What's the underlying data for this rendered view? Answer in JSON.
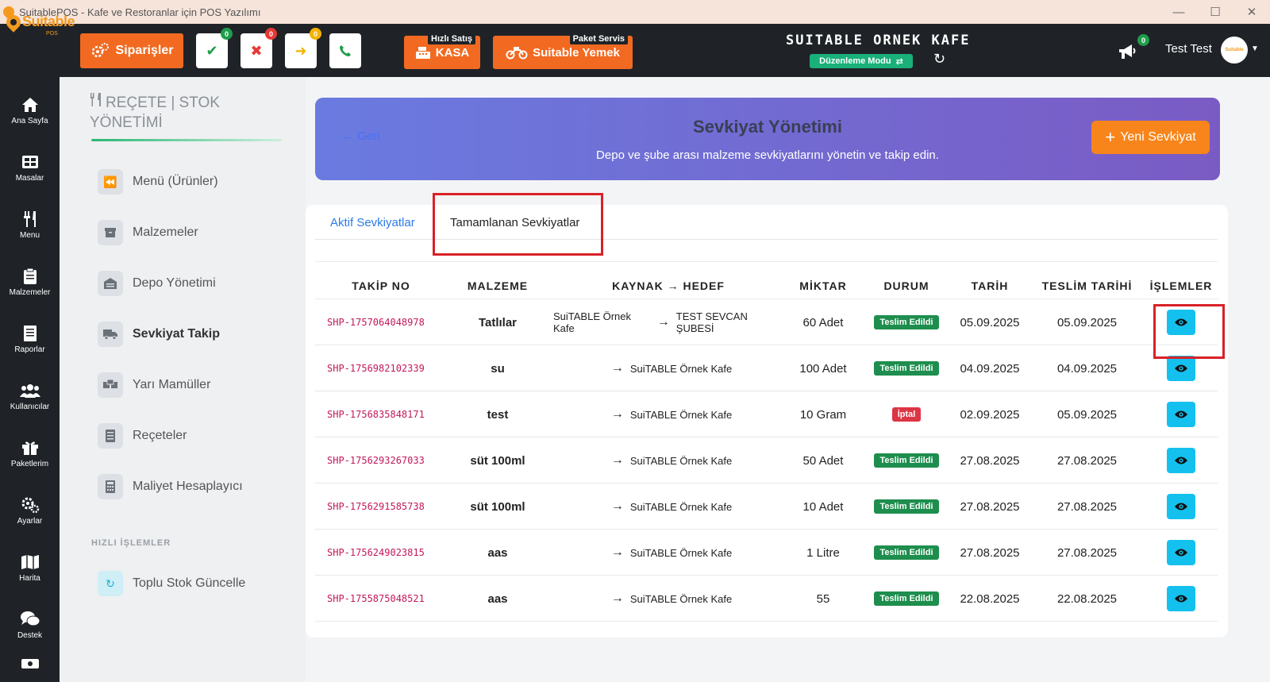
{
  "window": {
    "title": "SuitablePOS - Kafe ve Restoranlar için POS Yazılımı"
  },
  "header": {
    "logo_text": "Suitable",
    "logo_sub": "POS",
    "orders_label": "Siparişler",
    "badges": {
      "approved": "0",
      "cancelled": "0",
      "waiting": "0"
    },
    "quick_sale_label": "Hızlı Satış",
    "kasa_label": "KASA",
    "package_label": "Paket Servis",
    "suitable_yemek_label": "Suitable Yemek",
    "cafe_name": "SUITABLE ORNEK KAFE",
    "mode_label": "Düzenleme Modu",
    "notif_count": "0",
    "user_name": "Test Test",
    "avatar_text": "Suitable"
  },
  "rail": {
    "items": [
      {
        "label": "Ana Sayfa",
        "icon": "home-icon"
      },
      {
        "label": "Masalar",
        "icon": "table-icon"
      },
      {
        "label": "Menu",
        "icon": "utensils-icon"
      },
      {
        "label": "Malzemeler",
        "icon": "clipboard-icon"
      },
      {
        "label": "Raporlar",
        "icon": "report-icon"
      },
      {
        "label": "Kullanıcılar",
        "icon": "users-icon"
      },
      {
        "label": "Paketlerim",
        "icon": "gift-icon"
      },
      {
        "label": "Ayarlar",
        "icon": "gears-icon"
      },
      {
        "label": "Harita",
        "icon": "map-icon"
      },
      {
        "label": "Destek",
        "icon": "chat-icon"
      }
    ]
  },
  "subnav": {
    "heading": "REÇETE | STOK YÖNETİMİ",
    "items": [
      {
        "label": "Menü (Ürünler)",
        "icon": "backward-icon"
      },
      {
        "label": "Malzemeler",
        "icon": "box-icon"
      },
      {
        "label": "Depo Yönetimi",
        "icon": "warehouse-icon"
      },
      {
        "label": "Sevkiyat Takip",
        "icon": "truck-icon"
      },
      {
        "label": "Yarı Mamüller",
        "icon": "boxes-icon"
      },
      {
        "label": "Reçeteler",
        "icon": "list-icon"
      },
      {
        "label": "Maliyet Hesaplayıcı",
        "icon": "calculator-icon"
      }
    ],
    "quick_heading": "HIZLI İŞLEMLER",
    "quick_item": "Toplu Stok Güncelle"
  },
  "banner": {
    "back_label": "Geri",
    "title": "Sevkiyat Yönetimi",
    "subtitle": "Depo ve şube arası malzeme sevkiyatlarını yönetin ve takip edin.",
    "new_label": "Yeni Sevkiyat"
  },
  "tabs": {
    "active": "Aktif Sevkiyatlar",
    "completed": "Tamamlanan Sevkiyatlar"
  },
  "table": {
    "headers": [
      "TAKİP NO",
      "MALZEME",
      "KAYNAK → HEDEF",
      "MİKTAR",
      "DURUM",
      "TARİH",
      "TESLİM TARİHİ",
      "İŞLEMLER"
    ],
    "rows": [
      {
        "code": "SHP-1757064048978",
        "name": "Tatlılar",
        "source": "SuiTABLE Örnek Kafe",
        "target": "TEST SEVCAN ŞUBESİ",
        "qty": "60 Adet",
        "status": "Teslim Edildi",
        "date": "05.09.2025",
        "delivered": "05.09.2025"
      },
      {
        "code": "SHP-1756982102339",
        "name": "su",
        "source": "",
        "target": "SuiTABLE Örnek Kafe",
        "qty": "100 Adet",
        "status": "Teslim Edildi",
        "date": "04.09.2025",
        "delivered": "04.09.2025"
      },
      {
        "code": "SHP-1756835848171",
        "name": "test",
        "source": "",
        "target": "SuiTABLE Örnek Kafe",
        "qty": "10 Gram",
        "status": "İptal",
        "date": "02.09.2025",
        "delivered": "05.09.2025"
      },
      {
        "code": "SHP-1756293267033",
        "name": "süt 100ml",
        "source": "",
        "target": "SuiTABLE Örnek Kafe",
        "qty": "50 Adet",
        "status": "Teslim Edildi",
        "date": "27.08.2025",
        "delivered": "27.08.2025"
      },
      {
        "code": "SHP-1756291585738",
        "name": "süt 100ml",
        "source": "",
        "target": "SuiTABLE Örnek Kafe",
        "qty": "10 Adet",
        "status": "Teslim Edildi",
        "date": "27.08.2025",
        "delivered": "27.08.2025"
      },
      {
        "code": "SHP-1756249023815",
        "name": "aas",
        "source": "",
        "target": "SuiTABLE Örnek Kafe",
        "qty": "1 Litre",
        "status": "Teslim Edildi",
        "date": "27.08.2025",
        "delivered": "27.08.2025"
      },
      {
        "code": "SHP-1755875048521",
        "name": "aas",
        "source": "",
        "target": "SuiTABLE Örnek Kafe",
        "qty": "55",
        "status": "Teslim Edildi",
        "date": "22.08.2025",
        "delivered": "22.08.2025"
      }
    ]
  },
  "colors": {
    "accent_orange": "#f26a21",
    "status_delivered": "#1e8e4e",
    "status_cancelled": "#dc3545",
    "eye_button": "#14c1ee",
    "highlight_red": "#d92128"
  }
}
